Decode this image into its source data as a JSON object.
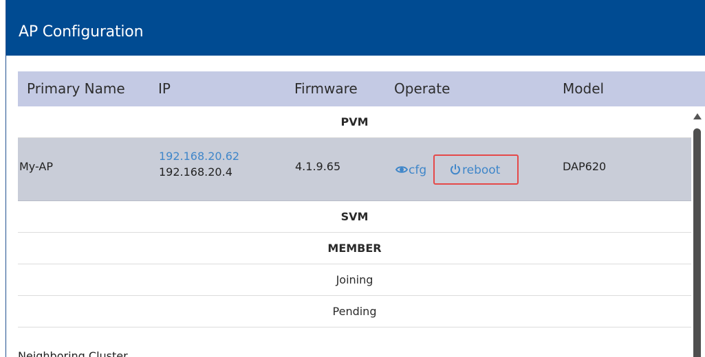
{
  "window": {
    "title": "AP Configuration",
    "colors": {
      "title_bar": "#004b92",
      "header_row": "#c4cae4",
      "selected_row": "#c9cdd8",
      "link": "#3f86c9",
      "highlight_border": "#e54848"
    }
  },
  "table": {
    "columns": [
      "Primary Name",
      "IP",
      "Firmware",
      "Operate",
      "Model"
    ],
    "sections": [
      {
        "label": "PVM",
        "rows": [
          {
            "primary_name": "My-AP",
            "ip_primary": "192.168.20.62",
            "ip_secondary": "192.168.20.4",
            "firmware": "4.1.9.65",
            "operate": [
              {
                "label": "cfg",
                "icon": "eye-icon"
              },
              {
                "label": "reboot",
                "icon": "power-icon"
              }
            ],
            "model": "DAP620"
          }
        ]
      },
      {
        "label": "SVM",
        "rows": []
      },
      {
        "label": "MEMBER",
        "rows": []
      }
    ],
    "status_rows": [
      "Joining",
      "Pending"
    ]
  },
  "footer": {
    "neighboring_cluster_label": "Neighboring Cluster"
  }
}
